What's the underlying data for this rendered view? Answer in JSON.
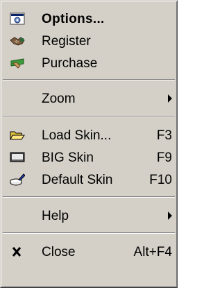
{
  "menu": {
    "options": {
      "label": "Options...",
      "icon": "options-icon"
    },
    "register": {
      "label": "Register",
      "icon": "handshake-icon"
    },
    "purchase": {
      "label": "Purchase",
      "icon": "purchase-icon"
    },
    "zoom": {
      "label": "Zoom"
    },
    "load_skin": {
      "label": "Load Skin...",
      "shortcut": "F3",
      "icon": "folder-open-icon"
    },
    "big_skin": {
      "label": "BIG Skin",
      "shortcut": "F9",
      "icon": "monitor-icon"
    },
    "default_skin": {
      "label": "Default Skin",
      "shortcut": "F10",
      "icon": "paint-bucket-icon"
    },
    "help": {
      "label": "Help"
    },
    "close": {
      "label": "Close",
      "shortcut": "Alt+F4",
      "icon": "close-icon"
    }
  }
}
